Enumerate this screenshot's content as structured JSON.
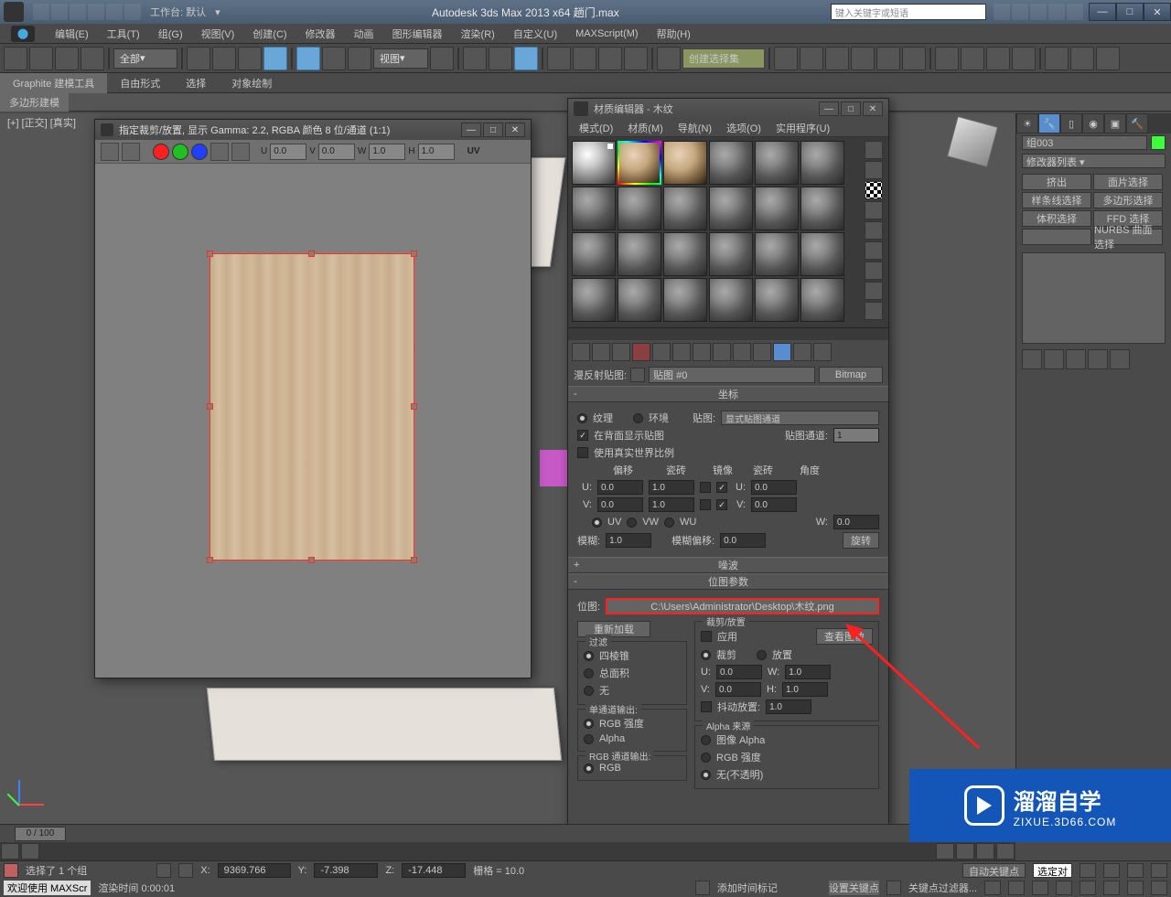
{
  "titlebar": {
    "workspace_label": "工作台: 默认",
    "title": "Autodesk 3ds Max  2013 x64      趟门.max",
    "search_placeholder": "键入关键字或短语"
  },
  "menu": {
    "items": [
      "编辑(E)",
      "工具(T)",
      "组(G)",
      "视图(V)",
      "创建(C)",
      "修改器",
      "动画",
      "图形编辑器",
      "渲染(R)",
      "自定义(U)",
      "MAXScript(M)",
      "帮助(H)"
    ]
  },
  "toolbar": {
    "sel_filter": "全部",
    "view_label": "视图",
    "named_sel": "创建选择集"
  },
  "ribbon": {
    "tabs": [
      "Graphite 建模工具",
      "自由形式",
      "选择",
      "对象绘制"
    ],
    "subtab": "多边形建模"
  },
  "viewport": {
    "label": "[+] [正交] [真实]"
  },
  "cropwin": {
    "title": "指定裁剪/放置, 显示 Gamma: 2.2, RGBA 颜色 8 位/通道 (1:1)",
    "u_label": "U",
    "u_val": "0.0",
    "v_label": "V",
    "v_val": "0.0",
    "w_label": "W",
    "w_val": "1.0",
    "h_label": "H",
    "h_val": "1.0",
    "uv_label": "UV"
  },
  "matedit": {
    "title": "材质编辑器 - 木纹",
    "menu": [
      "模式(D)",
      "材质(M)",
      "导航(N)",
      "选项(O)",
      "实用程序(U)"
    ],
    "diffuse_label": "漫反射贴图:",
    "map_name": "贴图 #0",
    "map_type": "Bitmap",
    "coord": {
      "header": "坐标",
      "texture": "纹理",
      "env": "环境",
      "mapping_label": "贴图:",
      "mapping_val": "显式贴图通道",
      "showback": "在背面显示贴图",
      "usereal": "使用真实世界比例",
      "mapch_label": "贴图通道:",
      "mapch_val": "1",
      "offset": "偏移",
      "tile": "瓷砖",
      "mirror": "镜像",
      "tile2": "瓷砖",
      "angle": "角度",
      "u_label": "U:",
      "u_off": "0.0",
      "u_tile": "1.0",
      "u_ang": "0.0",
      "v_label": "V:",
      "v_off": "0.0",
      "v_tile": "1.0",
      "v_ang": "0.0",
      "w_label": "W:",
      "w_ang": "0.0",
      "uv": "UV",
      "vw": "VW",
      "wu": "WU",
      "blur_label": "模糊:",
      "blur_val": "1.0",
      "bluroff_label": "模糊偏移:",
      "bluroff_val": "0.0",
      "rotate": "旋转"
    },
    "noise_header": "噪波",
    "bitmap": {
      "header": "位图参数",
      "bitmap_label": "位图:",
      "bitmap_path": "C:\\Users\\Administrator\\Desktop\\木纹.png",
      "reload": "重新加载",
      "crop_header": "裁剪/放置",
      "apply": "应用",
      "view": "查看图像",
      "crop": "裁剪",
      "place": "放置",
      "u_label": "U:",
      "u_val": "0.0",
      "w_label": "W:",
      "w_val": "1.0",
      "v_label": "V:",
      "v_val": "0.0",
      "h_label": "H:",
      "h_val": "1.0",
      "jitter": "抖动放置:",
      "jitter_val": "1.0",
      "filter_header": "过滤",
      "pyramidal": "四棱锥",
      "summed": "总面积",
      "none": "无",
      "mono_header": "单通道输出:",
      "rgb_int": "RGB 强度",
      "alpha": "Alpha",
      "rgbch_header": "RGB 通道输出:",
      "rgb": "RGB",
      "alpha_src_header": "Alpha 来源",
      "img_alpha": "图像 Alpha",
      "rgb_int2": "RGB 强度",
      "no_opaque": "无(不透明)"
    }
  },
  "cmdpanel": {
    "objname": "组003",
    "modlist": "修改器列表",
    "buttons": [
      "挤出",
      "面片选择",
      "样条线选择",
      "多边形选择",
      "体积选择",
      "FFD 选择",
      "",
      "NURBS 曲面选择"
    ]
  },
  "status": {
    "sel": "选择了 1 个组",
    "x_label": "X:",
    "x": "9369.766",
    "y_label": "Y:",
    "y": "-7.398",
    "z_label": "Z:",
    "z": "-17.448",
    "grid": "栅格 = 10.0",
    "autokey": "自动关键点",
    "selkey": "选定对",
    "setkey": "设置关键点",
    "keyfilter": "关键点过滤器...",
    "addtime": "添加时间标记"
  },
  "bottom": {
    "welcome": "欢迎使用 MAXScr",
    "render": "渲染时间  0:00:01"
  },
  "timeslider": {
    "frame": "0 / 100"
  },
  "watermark": {
    "big": "溜溜自学",
    "small": "ZIXUE.3D66.COM"
  }
}
